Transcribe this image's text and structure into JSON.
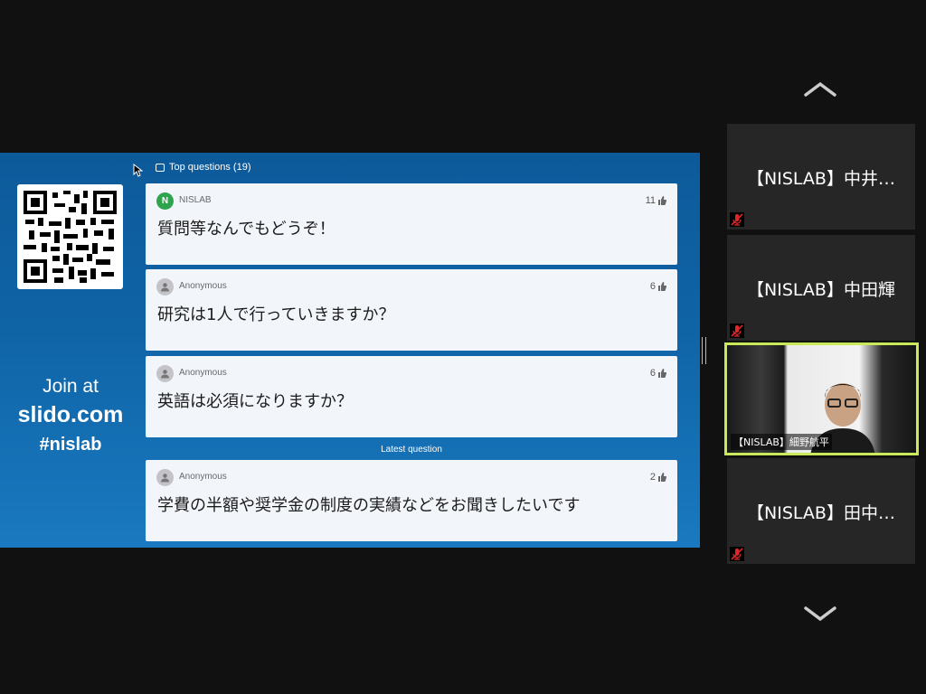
{
  "slide": {
    "top_questions_label": "Top questions (19)",
    "join_line1": "Join at",
    "join_line2": "slido.com",
    "join_line3": "#nislab",
    "latest_label": "Latest question",
    "questions": [
      {
        "author": "NISLAB",
        "avatar_letter": "N",
        "likes": "11",
        "text": "質問等なんでもどうぞ！"
      },
      {
        "author": "Anonymous",
        "avatar_letter": "",
        "likes": "6",
        "text": "研究は1人で行っていきますか？"
      },
      {
        "author": "Anonymous",
        "avatar_letter": "",
        "likes": "6",
        "text": "英語は必須になりますか？"
      }
    ],
    "latest_question": {
      "author": "Anonymous",
      "avatar_letter": "",
      "likes": "2",
      "text": "学費の半額や奨学金の制度の実績などをお聞きしたいです"
    }
  },
  "participants": [
    {
      "name": "【NISLAB】中井…",
      "muted": true
    },
    {
      "name": "【NISLAB】中田輝",
      "muted": true
    },
    {
      "name": "【NISLAB】細野航平",
      "video": true
    },
    {
      "name": "【NISLAB】田中…",
      "muted": true
    }
  ],
  "icons": {
    "scroll_up": "chevron-up-icon",
    "scroll_down": "chevron-down-icon",
    "mute": "mic-muted-icon",
    "like": "thumbs-up-icon"
  },
  "colors": {
    "slide_blue": "#0f64a6",
    "active_speaker_border": "#c9e85a",
    "mute_red": "#e02828"
  }
}
